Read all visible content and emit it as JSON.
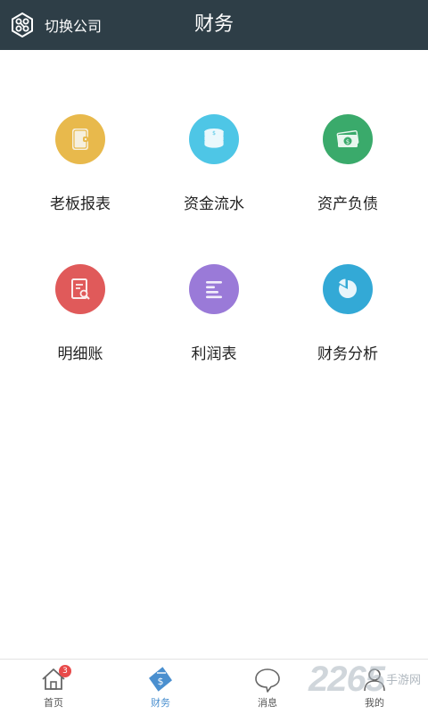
{
  "header": {
    "switch_label": "切换公司",
    "title": "财务"
  },
  "grid": {
    "items": [
      {
        "label": "老板报表",
        "icon": "wallet-icon",
        "color": "#e8b94c"
      },
      {
        "label": "资金流水",
        "icon": "coin-stack-icon",
        "color": "#4ec6e6"
      },
      {
        "label": "资产负债",
        "icon": "banknote-icon",
        "color": "#3aaa6b"
      },
      {
        "label": "明细账",
        "icon": "document-search-icon",
        "color": "#e05a5a"
      },
      {
        "label": "利润表",
        "icon": "list-lines-icon",
        "color": "#9a7ad8"
      },
      {
        "label": "财务分析",
        "icon": "pie-chart-icon",
        "color": "#33a9d6"
      }
    ]
  },
  "tabbar": {
    "tabs": [
      {
        "label": "首页",
        "icon": "home-icon",
        "badge": "3"
      },
      {
        "label": "财务",
        "icon": "finance-icon",
        "active": true
      },
      {
        "label": "消息",
        "icon": "chat-bubble-icon"
      },
      {
        "label": "我的",
        "icon": "user-icon"
      }
    ],
    "active_color": "#4a8fcf"
  },
  "watermark": {
    "number": "2265",
    "text": "手游网"
  },
  "colors": {
    "header_bg": "#2e3e47"
  }
}
